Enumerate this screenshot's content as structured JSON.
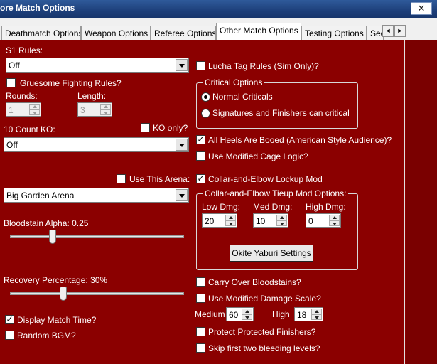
{
  "window": {
    "title": "ore Match Options",
    "close_glyph": "✕"
  },
  "tabs": [
    {
      "label": "Deathmatch Options",
      "active": false
    },
    {
      "label": "Weapon Options",
      "active": false
    },
    {
      "label": "Referee Options",
      "active": false
    },
    {
      "label": "Other Match Options",
      "active": true
    },
    {
      "label": "Testing Options",
      "active": false
    },
    {
      "label": "Sec",
      "active": false
    }
  ],
  "tab_scroll": {
    "left": "◄",
    "right": "►"
  },
  "left": {
    "s1_rules_label": "S1 Rules:",
    "s1_rules_value": "Off",
    "gruesome_label": "Gruesome Fighting Rules?",
    "gruesome_checked": false,
    "rounds_label": "Rounds:",
    "rounds_value": "1",
    "length_label": "Length:",
    "length_value": "3",
    "count_ko_label": "10 Count KO:",
    "ko_only_label": "KO only?",
    "ko_only_checked": false,
    "count_ko_value": "Off",
    "use_arena_label": "Use This Arena:",
    "use_arena_checked": false,
    "arena_value": "Big Garden Arena",
    "bloodstain_label": "Bloodstain Alpha: 0.25",
    "bloodstain_value": 0.25,
    "recovery_label": "Recovery Percentage: 30%",
    "recovery_value": 30,
    "display_time_label": "Display Match Time?",
    "display_time_checked": true,
    "random_bgm_label": "Random BGM?",
    "random_bgm_checked": false
  },
  "right": {
    "lucha_label": "Lucha Tag Rules (Sim Only)?",
    "lucha_checked": false,
    "critical_title": "Critical Options",
    "normal_crit_label": "Normal Criticals",
    "normal_crit_selected": true,
    "sig_crit_label": "Signatures and Finishers can critical",
    "sig_crit_selected": false,
    "heels_booed_label": "All Heels Are Booed (American Style Audience)?",
    "heels_booed_checked": true,
    "cage_logic_label": "Use Modified Cage Logic?",
    "cage_logic_checked": false,
    "collar_lockup_label": "Collar-and-Elbow Lockup Mod",
    "collar_lockup_checked": true,
    "tieup_title": "Collar-and-Elbow Tieup Mod Options:",
    "low_dmg_label": "Low Dmg:",
    "low_dmg_value": "20",
    "med_dmg_label": "Med Dmg:",
    "med_dmg_value": "10",
    "high_dmg_label": "High Dmg:",
    "high_dmg_value": "0",
    "okite_button": "Okite Yaburi Settings",
    "carry_blood_label": "Carry Over Bloodstains?",
    "carry_blood_checked": false,
    "damage_scale_label": "Use Modified Damage Scale?",
    "damage_scale_checked": false,
    "medium_label": "Medium",
    "medium_value": "60",
    "high_label": "High",
    "high_value": "18",
    "protect_label": "Protect Protected Finishers?",
    "protect_checked": false,
    "skip_bleed_label": "Skip first two bleeding levels?",
    "skip_bleed_checked": false
  }
}
